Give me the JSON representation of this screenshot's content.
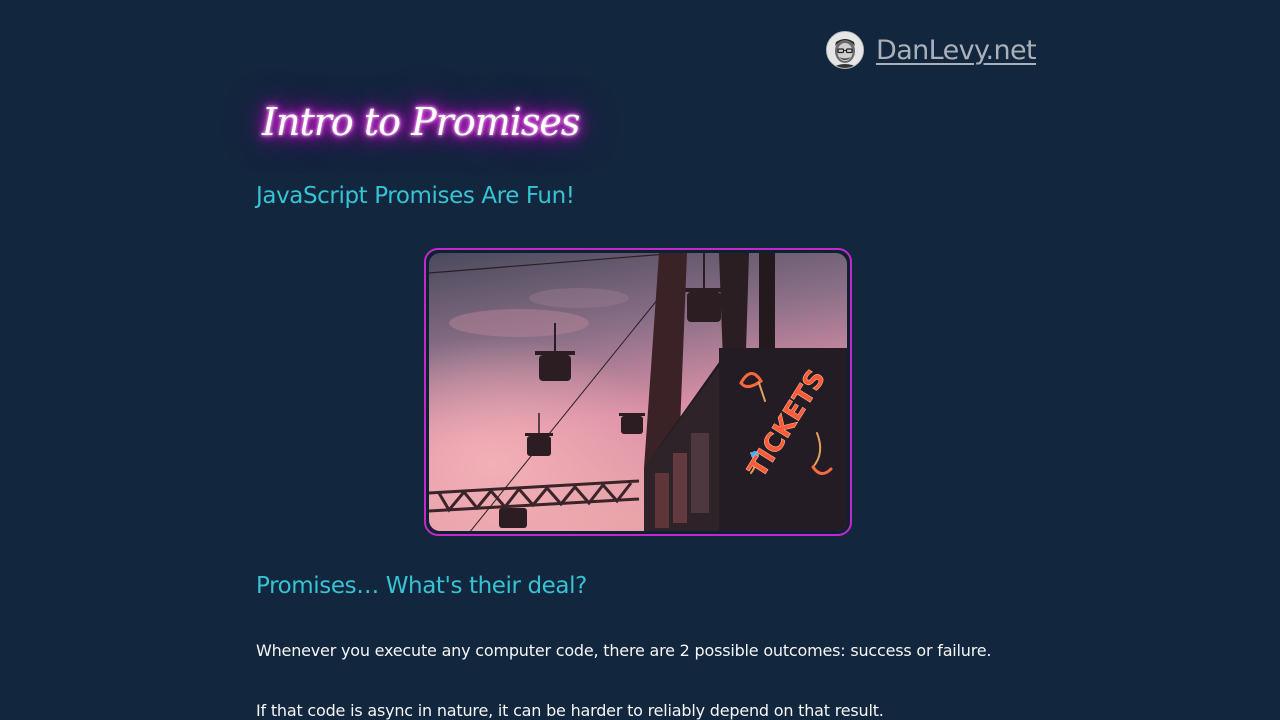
{
  "site": {
    "name": "DanLevy.net"
  },
  "post": {
    "title": "Intro to Promises",
    "subtitle": "JavaScript Promises Are Fun!",
    "hero_sign_text": "TICKETS",
    "section_heading": "Promises… What's their deal?",
    "paragraphs": [
      "Whenever you execute any computer code, there are 2 possible outcomes: success or failure.",
      "If that code is async in nature, it can be harder to reliably depend on that result."
    ]
  },
  "colors": {
    "background": "#12263d",
    "accent_cyan": "#36c3d4",
    "accent_magenta": "#c12ac8",
    "neon_glow": "#ff4dff",
    "brand_link": "#a9b0b9"
  }
}
